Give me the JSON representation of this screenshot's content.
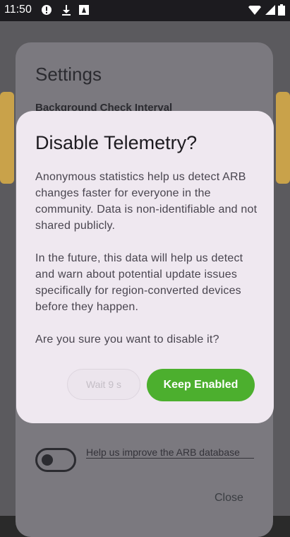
{
  "status_bar": {
    "time": "11:50"
  },
  "background": {
    "settings_title": "Settings",
    "interval_label": "Background Check Interval",
    "improve_text": "Help us improve the ARB database",
    "close_label": "Close"
  },
  "dialog": {
    "title": "Disable Telemetry?",
    "paragraphs": [
      "Anonymous statistics help us detect ARB changes faster for everyone in the community. Data is non-identifiable and not shared publicly.",
      "In the future, this data will help us detect and warn about potential update issues specifically for region-converted devices before they happen.",
      "Are you sure you want to disable it?"
    ],
    "wait_button": "Wait 9 s",
    "keep_button": "Keep Enabled"
  },
  "colors": {
    "accent": "#4caf2e",
    "dialog_bg": "#efe8f0",
    "scrim": "#5b5a5e"
  }
}
